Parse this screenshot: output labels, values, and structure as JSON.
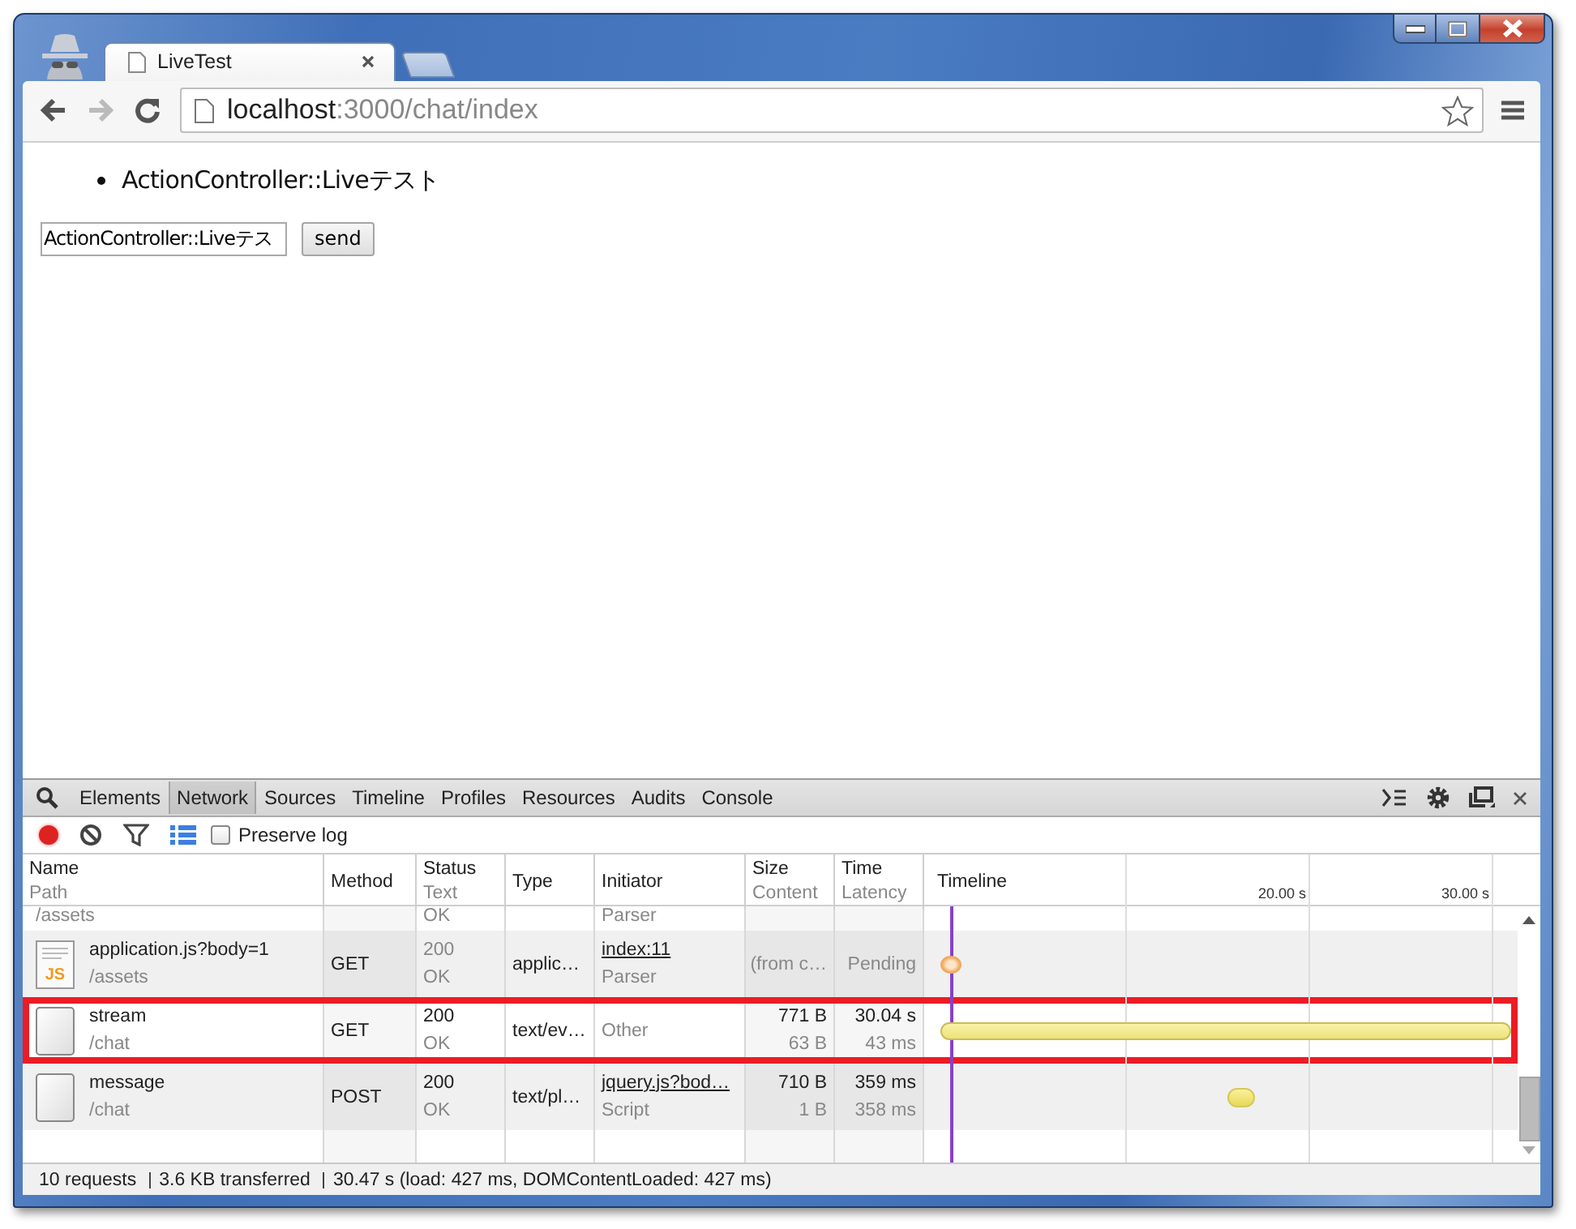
{
  "browser": {
    "tab": {
      "title": "LiveTest"
    },
    "nav": {
      "forward_disabled": true
    },
    "address": {
      "host": "localhost",
      "rest": ":3000/chat/index"
    }
  },
  "page": {
    "items": [
      "ActionController::Liveテスト"
    ],
    "input": {
      "value": "ActionController::Liveテス"
    },
    "button": "send"
  },
  "devtools": {
    "tabs": [
      {
        "label": "Elements",
        "selected": false
      },
      {
        "label": "Network",
        "selected": true
      },
      {
        "label": "Sources",
        "selected": false
      },
      {
        "label": "Timeline",
        "selected": false
      },
      {
        "label": "Profiles",
        "selected": false
      },
      {
        "label": "Resources",
        "selected": false
      },
      {
        "label": "Audits",
        "selected": false
      },
      {
        "label": "Console",
        "selected": false
      }
    ],
    "toolbar": {
      "recording": true,
      "large_rows": true,
      "preserve_log": {
        "label": "Preserve log",
        "checked": false
      }
    },
    "columns": [
      {
        "title": "Name",
        "subtitle": "Path"
      },
      {
        "title": "Method"
      },
      {
        "title": "Status",
        "subtitle": "Text"
      },
      {
        "title": "Type"
      },
      {
        "title": "Initiator"
      },
      {
        "title": "Size",
        "subtitle": "Content"
      },
      {
        "title": "Time",
        "subtitle": "Latency"
      },
      {
        "title": "Timeline"
      }
    ],
    "timeline_ticks": [
      "20.00 s",
      "30.00 s"
    ],
    "rows": [
      {
        "kind": "partial",
        "path": "/assets",
        "status_text": "OK",
        "initiator_sub": "Parser",
        "highlighted": false
      },
      {
        "kind": "full",
        "icon": {
          "kind": "script",
          "label": "JS"
        },
        "name": "application.js?body=1",
        "path": "/assets",
        "method": "GET",
        "cached": true,
        "status": "200",
        "status_text": "OK",
        "type": "applic…",
        "initiator": "index:11",
        "initiator_sub": "Parser",
        "size": "(from c…",
        "time": "Pending",
        "bar": {
          "kind": "pending"
        },
        "highlighted": false
      },
      {
        "kind": "full",
        "icon": {
          "kind": "document"
        },
        "name": "stream",
        "path": "/chat",
        "method": "GET",
        "cached": false,
        "status": "200",
        "status_text": "OK",
        "type": "text/ev…",
        "initiator": "Other",
        "size": "771 B",
        "content": "63 B",
        "time": "30.04 s",
        "latency": "43 ms",
        "bar": {
          "kind": "long"
        },
        "highlighted": true
      },
      {
        "kind": "full",
        "icon": {
          "kind": "document"
        },
        "name": "message",
        "path": "/chat",
        "method": "POST",
        "cached": false,
        "status": "200",
        "status_text": "OK",
        "type": "text/pl…",
        "initiator": "jquery.js?bod…",
        "initiator_sub": "Script",
        "size": "710 B",
        "content": "1 B",
        "time": "359 ms",
        "latency": "358 ms",
        "bar": {
          "kind": "short"
        },
        "highlighted": false
      }
    ],
    "status_bar": [
      "10 requests",
      "3.6 KB transferred",
      "30.47 s (load: 427 ms, DOMContentLoaded: 427 ms)"
    ]
  }
}
